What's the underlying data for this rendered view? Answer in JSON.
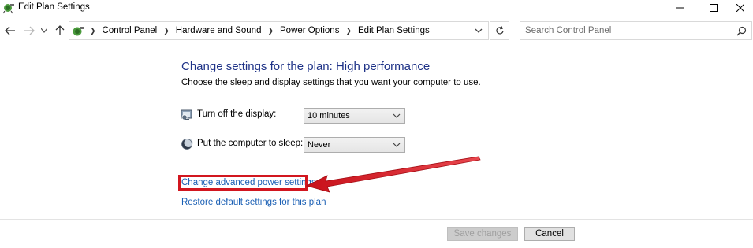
{
  "window": {
    "title": "Edit Plan Settings"
  },
  "address_bar": {
    "breadcrumbs": [
      "Control Panel",
      "Hardware and Sound",
      "Power Options",
      "Edit Plan Settings"
    ]
  },
  "search": {
    "placeholder": "Search Control Panel"
  },
  "main": {
    "heading": "Change settings for the plan: High performance",
    "subtitle": "Choose the sleep and display settings that you want your computer to use.",
    "settings": [
      {
        "label": "Turn off the display:",
        "value": "10 minutes"
      },
      {
        "label": "Put the computer to sleep:",
        "value": "Never"
      }
    ],
    "links": {
      "advanced": "Change advanced power settings",
      "restore": "Restore default settings for this plan"
    }
  },
  "footer": {
    "save_label": "Save changes",
    "cancel_label": "Cancel"
  },
  "colors": {
    "heading": "#1e3287",
    "link": "#1a5fb4",
    "annotation": "#d2161f"
  }
}
